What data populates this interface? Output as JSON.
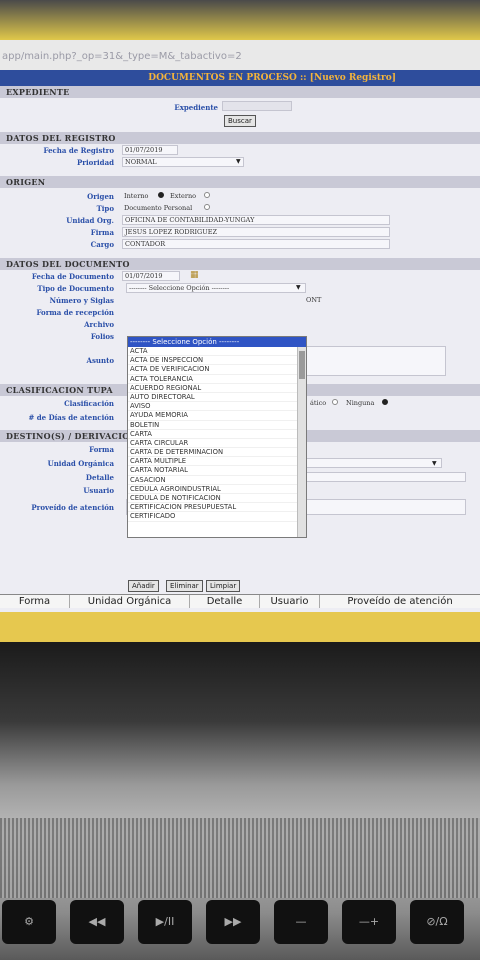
{
  "browser": {
    "url": "app/main.php?_op=31&_type=M&_tabactivo=2"
  },
  "page": {
    "title": "DOCUMENTOS EN PROCESO :: [Nuevo Registro]"
  },
  "expediente": {
    "section": "EXPEDIENTE",
    "label": "Expediente",
    "value": "",
    "search_button": "Buscar"
  },
  "registro": {
    "section": "DATOS DEL REGISTRO",
    "fecha_label": "Fecha de Registro",
    "fecha_value": "01/07/2019",
    "prioridad_label": "Prioridad",
    "prioridad_value": "NORMAL"
  },
  "origen": {
    "section": "ORIGEN",
    "origen_label": "Origen",
    "interno": "Interno",
    "externo": "Externo",
    "tipo_label": "Tipo",
    "tipo_value": "Documento Personal",
    "unidad_label": "Unidad Org.",
    "unidad_value": "OFICINA DE CONTABILIDAD-YUNGAY",
    "firma_label": "Firma",
    "firma_value": "JESUS LOPEZ RODRIGUEZ",
    "cargo_label": "Cargo",
    "cargo_value": "CONTADOR"
  },
  "documento": {
    "section": "DATOS DEL DOCUMENTO",
    "fecha_label": "Fecha de Documento",
    "fecha_value": "01/07/2019",
    "tipo_label": "Tipo de Documento",
    "tipo_value": "-------- Seleccione Opción --------",
    "numero_label": "Número y Siglas",
    "numero_suffix": "ONT",
    "forma_label": "Forma de recepción",
    "archivo_label": "Archivo",
    "folios_label": "Folios",
    "asunto_label": "Asunto"
  },
  "dropdown": {
    "selected": "-------- Seleccione Opción --------",
    "options": [
      "ACTA",
      "ACTA DE INSPECCION",
      "ACTA DE VERIFICACION",
      "ACTA TOLERANCIA",
      "ACUERDO REGIONAL",
      "AUTO DIRECTORAL",
      "AVISO",
      "AYUDA MEMORIA",
      "BOLETIN",
      "CARTA",
      "CARTA CIRCULAR",
      "CARTA DE DETERMINACION",
      "CARTA MULTIPLE",
      "CARTA NOTARIAL",
      "CASACION",
      "CEDULA AGROINDUSTRIAL",
      "CEDULA DE NOTIFICACION",
      "CERTIFICACION PRESUPUESTAL",
      "CERTIFICADO"
    ]
  },
  "tupa": {
    "section": "CLASIFICACION TUPA",
    "clasificacion_label": "Clasificación",
    "automatico": "ático",
    "ninguna": "Ninguna",
    "dias_label": "# de Días de atención"
  },
  "destino": {
    "section": "DESTINO(S) / DERIVACIO",
    "forma_label": "Forma",
    "unidad_label": "Unidad Orgánica",
    "detalle_label": "Detalle",
    "usuario_label": "Usuario",
    "proveido_label": "Proveído de atención",
    "add_button": "Añadir",
    "remove_button": "Eliminar",
    "clear_button": "Limpiar"
  },
  "table": {
    "columns": [
      "Forma",
      "Unidad Orgánica",
      "Detalle",
      "Usuario",
      "Proveído de atención"
    ]
  },
  "keyboard": {
    "keys": [
      "⚙",
      "◀◀",
      "▶/II",
      "▶▶",
      "—",
      "—+",
      "⊘/Ω"
    ]
  }
}
